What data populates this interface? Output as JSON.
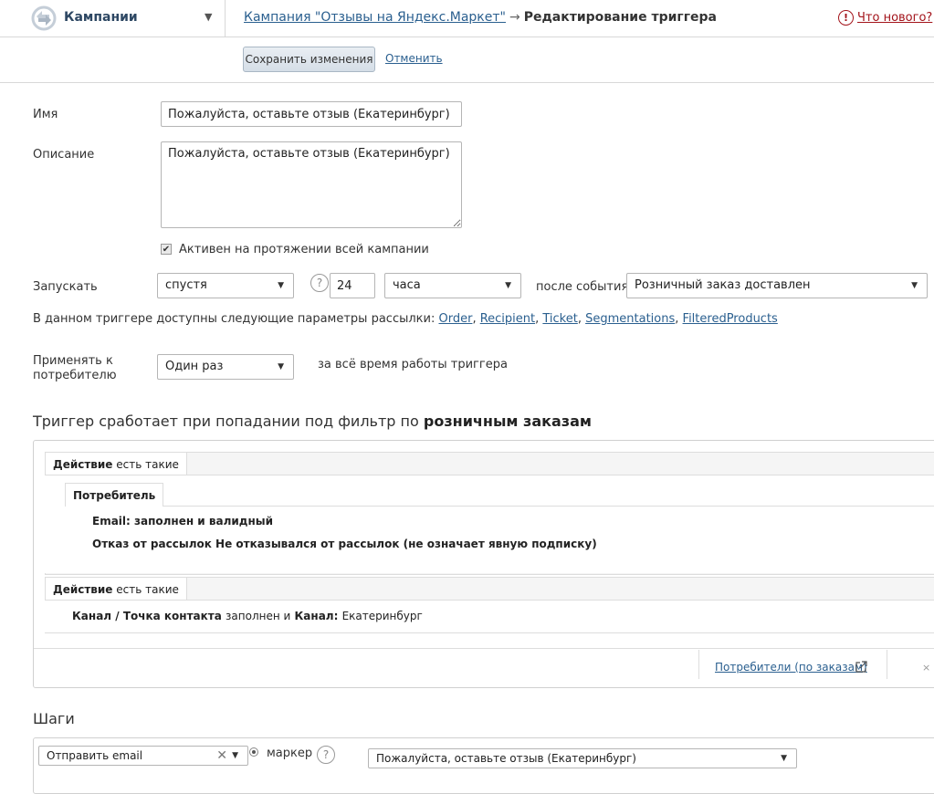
{
  "header": {
    "app_title": "Кампании",
    "breadcrumb_link": "Кампания \"Отзывы на Яндекс.Маркет\"",
    "breadcrumb_sep": "→",
    "breadcrumb_current": "Редактирование триггера",
    "whats_new": "Что нового?"
  },
  "actions": {
    "save": "Сохранить изменения",
    "cancel": "Отменить"
  },
  "form": {
    "name_label": "Имя",
    "name_value": "Пожалуйста, оставьте отзыв (Екатеринбург)",
    "desc_label": "Описание",
    "desc_value": "Пожалуйста, оставьте отзыв (Екатеринбург)",
    "active_label": "Активен на протяжении всей кампании",
    "active_checked": true,
    "launch_label": "Запускать",
    "launch_mode": "спустя",
    "launch_amount": "24",
    "launch_unit": "часа",
    "after_event_label": "после события",
    "event_value": "Розничный заказ доставлен",
    "params_text": "В данном триггере доступны следующие параметры рассылки:",
    "params": [
      "Order",
      "Recipient",
      "Ticket",
      "Segmentations",
      "FilteredProducts"
    ],
    "apply_label": "Применять к потребителю",
    "apply_value": "Один раз",
    "apply_note": "за всё время работы триггера"
  },
  "filter": {
    "title_prefix": "Триггер сработает при попадании под фильтр по",
    "title_bold": "розничным заказам",
    "group1": {
      "tab_bold": "Действие",
      "tab_rest": "есть такие",
      "inner_tab": "Потребитель",
      "cond1": "Email: заполнен и валидный",
      "cond2": "Отказ от рассылок Не отказывался от рассылок (не означает явную подписку)"
    },
    "group2": {
      "tab_bold": "Действие",
      "tab_rest": "есть такие",
      "cond_b1": "Канал / Точка контакта",
      "cond_n1": "заполнен и",
      "cond_b2": "Канал:",
      "cond_n2": "Екатеринбург"
    },
    "footer_link": "Потребители (по заказам)",
    "footer_cut": "× (",
    "external_icon": "external-link-icon"
  },
  "steps": {
    "title": "Шаги",
    "action_value": "Отправить email",
    "marker_label": "маркер",
    "template_value": "Пожалуйста, оставьте отзыв (Екатеринбург)"
  }
}
